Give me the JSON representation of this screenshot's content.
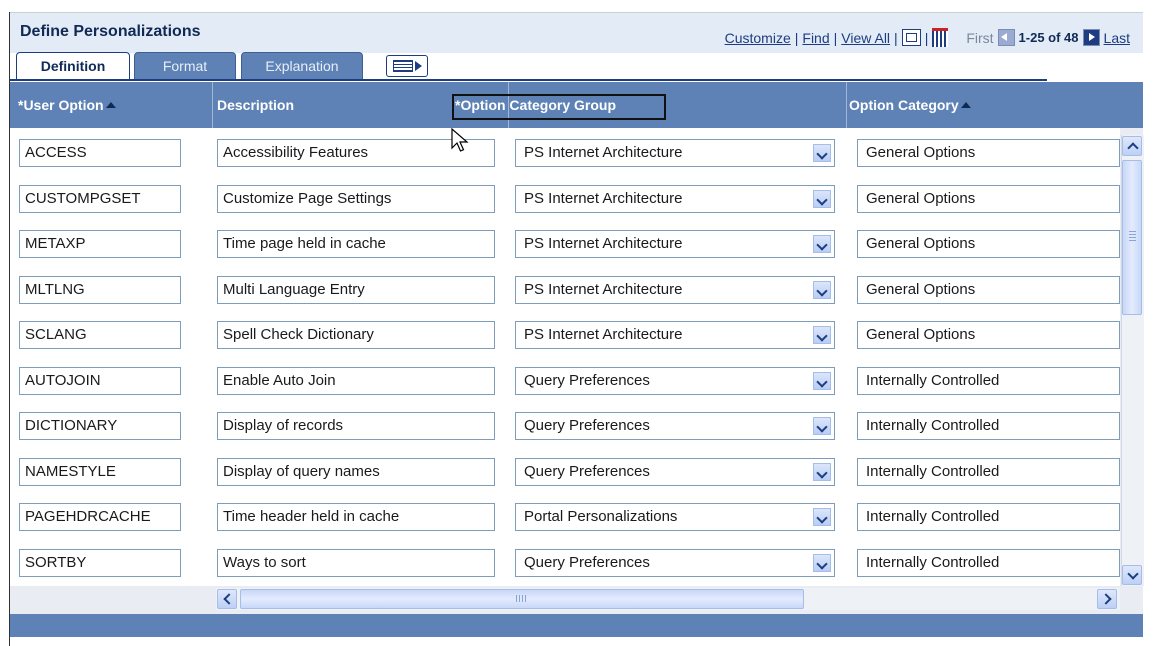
{
  "header": {
    "title": "Define Personalizations",
    "links": {
      "customize": "Customize",
      "find": "Find",
      "view_all": "View All"
    },
    "separator": "|",
    "nav": {
      "first": "First",
      "range": "1-25 of 48",
      "last": "Last"
    }
  },
  "tabs": [
    {
      "label": "Definition",
      "active": true
    },
    {
      "label": "Format",
      "active": false
    },
    {
      "label": "Explanation",
      "active": false
    }
  ],
  "columns": {
    "user_option": "*User Option",
    "description": "Description",
    "option_category_group": "*Option Category Group",
    "option_category": "Option Category"
  },
  "rows": [
    {
      "user_option": "ACCESS",
      "description": "Accessibility Features",
      "group": "PS Internet Architecture",
      "category": "General Options"
    },
    {
      "user_option": "CUSTOMPGSET",
      "description": "Customize Page Settings",
      "group": "PS Internet Architecture",
      "category": "General Options"
    },
    {
      "user_option": "METAXP",
      "description": "Time page held in cache",
      "group": "PS Internet Architecture",
      "category": "General Options"
    },
    {
      "user_option": "MLTLNG",
      "description": "Multi Language Entry",
      "group": "PS Internet Architecture",
      "category": "General Options"
    },
    {
      "user_option": "SCLANG",
      "description": "Spell Check Dictionary",
      "group": "PS Internet Architecture",
      "category": "General Options"
    },
    {
      "user_option": "AUTOJOIN",
      "description": "Enable Auto Join",
      "group": "Query Preferences",
      "category": "Internally Controlled"
    },
    {
      "user_option": "DICTIONARY",
      "description": "Display of records",
      "group": "Query Preferences",
      "category": "Internally Controlled"
    },
    {
      "user_option": "NAMESTYLE",
      "description": "Display of query names",
      "group": "Query Preferences",
      "category": "Internally Controlled"
    },
    {
      "user_option": "PAGEHDRCACHE",
      "description": "Time header held in cache",
      "group": "Portal Personalizations",
      "category": "Internally Controlled"
    },
    {
      "user_option": "SORTBY",
      "description": "Ways to sort",
      "group": "Query Preferences",
      "category": "Internally Controlled"
    }
  ]
}
